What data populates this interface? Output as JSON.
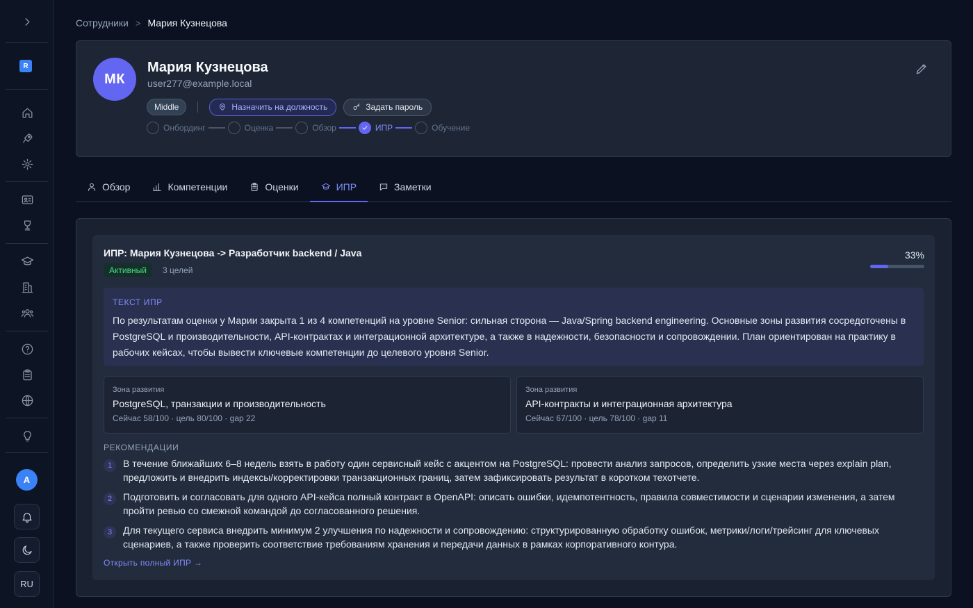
{
  "sidebar": {
    "logo_letter": "R",
    "user_initial": "A",
    "lang_label": "RU"
  },
  "breadcrumb": {
    "parent": "Сотрудники",
    "separator": ">",
    "current": "Мария Кузнецова"
  },
  "profile": {
    "initials": "МК",
    "name": "Мария Кузнецова",
    "email": "user277@example.local",
    "level": "Middle",
    "assign_label": "Назначить на должность",
    "password_label": "Задать пароль",
    "steps": [
      {
        "label": "Онбординг",
        "done": false
      },
      {
        "label": "Оценка",
        "done": false
      },
      {
        "label": "Обзор",
        "done": false
      },
      {
        "label": "ИПР",
        "done": true
      },
      {
        "label": "Обучение",
        "done": false
      }
    ]
  },
  "tabs": [
    {
      "label": "Обзор",
      "icon": "user-icon",
      "active": false
    },
    {
      "label": "Компетенции",
      "icon": "bar-chart-icon",
      "active": false
    },
    {
      "label": "Оценки",
      "icon": "clipboard-icon",
      "active": false
    },
    {
      "label": "ИПР",
      "icon": "graduation-cap-icon",
      "active": true
    },
    {
      "label": "Заметки",
      "icon": "message-icon",
      "active": false
    }
  ],
  "ipr": {
    "title": "ИПР: Мария Кузнецова -> Разработчик backend / Java",
    "status": "Активный",
    "goals": "3 целей",
    "progress_label": "33%",
    "progress": 0.33,
    "text_label": "ТЕКСТ ИПР",
    "text_body": "По результатам оценки у Марии закрыта 1 из 4 компетенций на уровне Senior: сильная сторона — Java/Spring backend engineering. Основные зоны развития сосредоточены в PostgreSQL и производительности, API-контрактах и интеграционной архитектуре, а также в надежности, безопасности и сопровождении. План ориентирован на практику в рабочих кейсах, чтобы вывести ключевые компетенции до целевого уровня Senior.",
    "zones": [
      {
        "label": "Зона развития",
        "title": "PostgreSQL, транзакции и производительность",
        "stats": "Сейчас 58/100 · цель 80/100 · gap 22"
      },
      {
        "label": "Зона развития",
        "title": "API-контракты и интеграционная архитектура",
        "stats": "Сейчас 67/100 · цель 78/100 · gap 11"
      }
    ],
    "rec_label": "РЕКОМЕНДАЦИИ",
    "recommendations": [
      {
        "num": "1",
        "text": "В течение ближайших 6–8 недель взять в работу один сервисный кейс с акцентом на PostgreSQL: провести анализ запросов, определить узкие места через explain plan, предложить и внедрить индексы/корректировки транзакционных границ, затем зафиксировать результат в коротком техотчете."
      },
      {
        "num": "2",
        "text": "Подготовить и согласовать для одного API-кейса полный контракт в OpenAPI: описать ошибки, идемпотентность, правила совместимости и сценарии изменения, а затем пройти ревью со смежной командой до согласованного решения."
      },
      {
        "num": "3",
        "text": "Для текущего сервиса внедрить минимум 2 улучшения по надежности и сопровождению: структурированную обработку ошибок, метрики/логи/трейсинг для ключевых сценариев, а также проверить соответствие требованиям хранения и передачи данных в рамках корпоративного контура."
      }
    ],
    "open_link": "Открыть полный ИПР →"
  },
  "colors": {
    "accent": "#6366f1",
    "status_green": "#4ade80",
    "background": "#0b1120"
  }
}
